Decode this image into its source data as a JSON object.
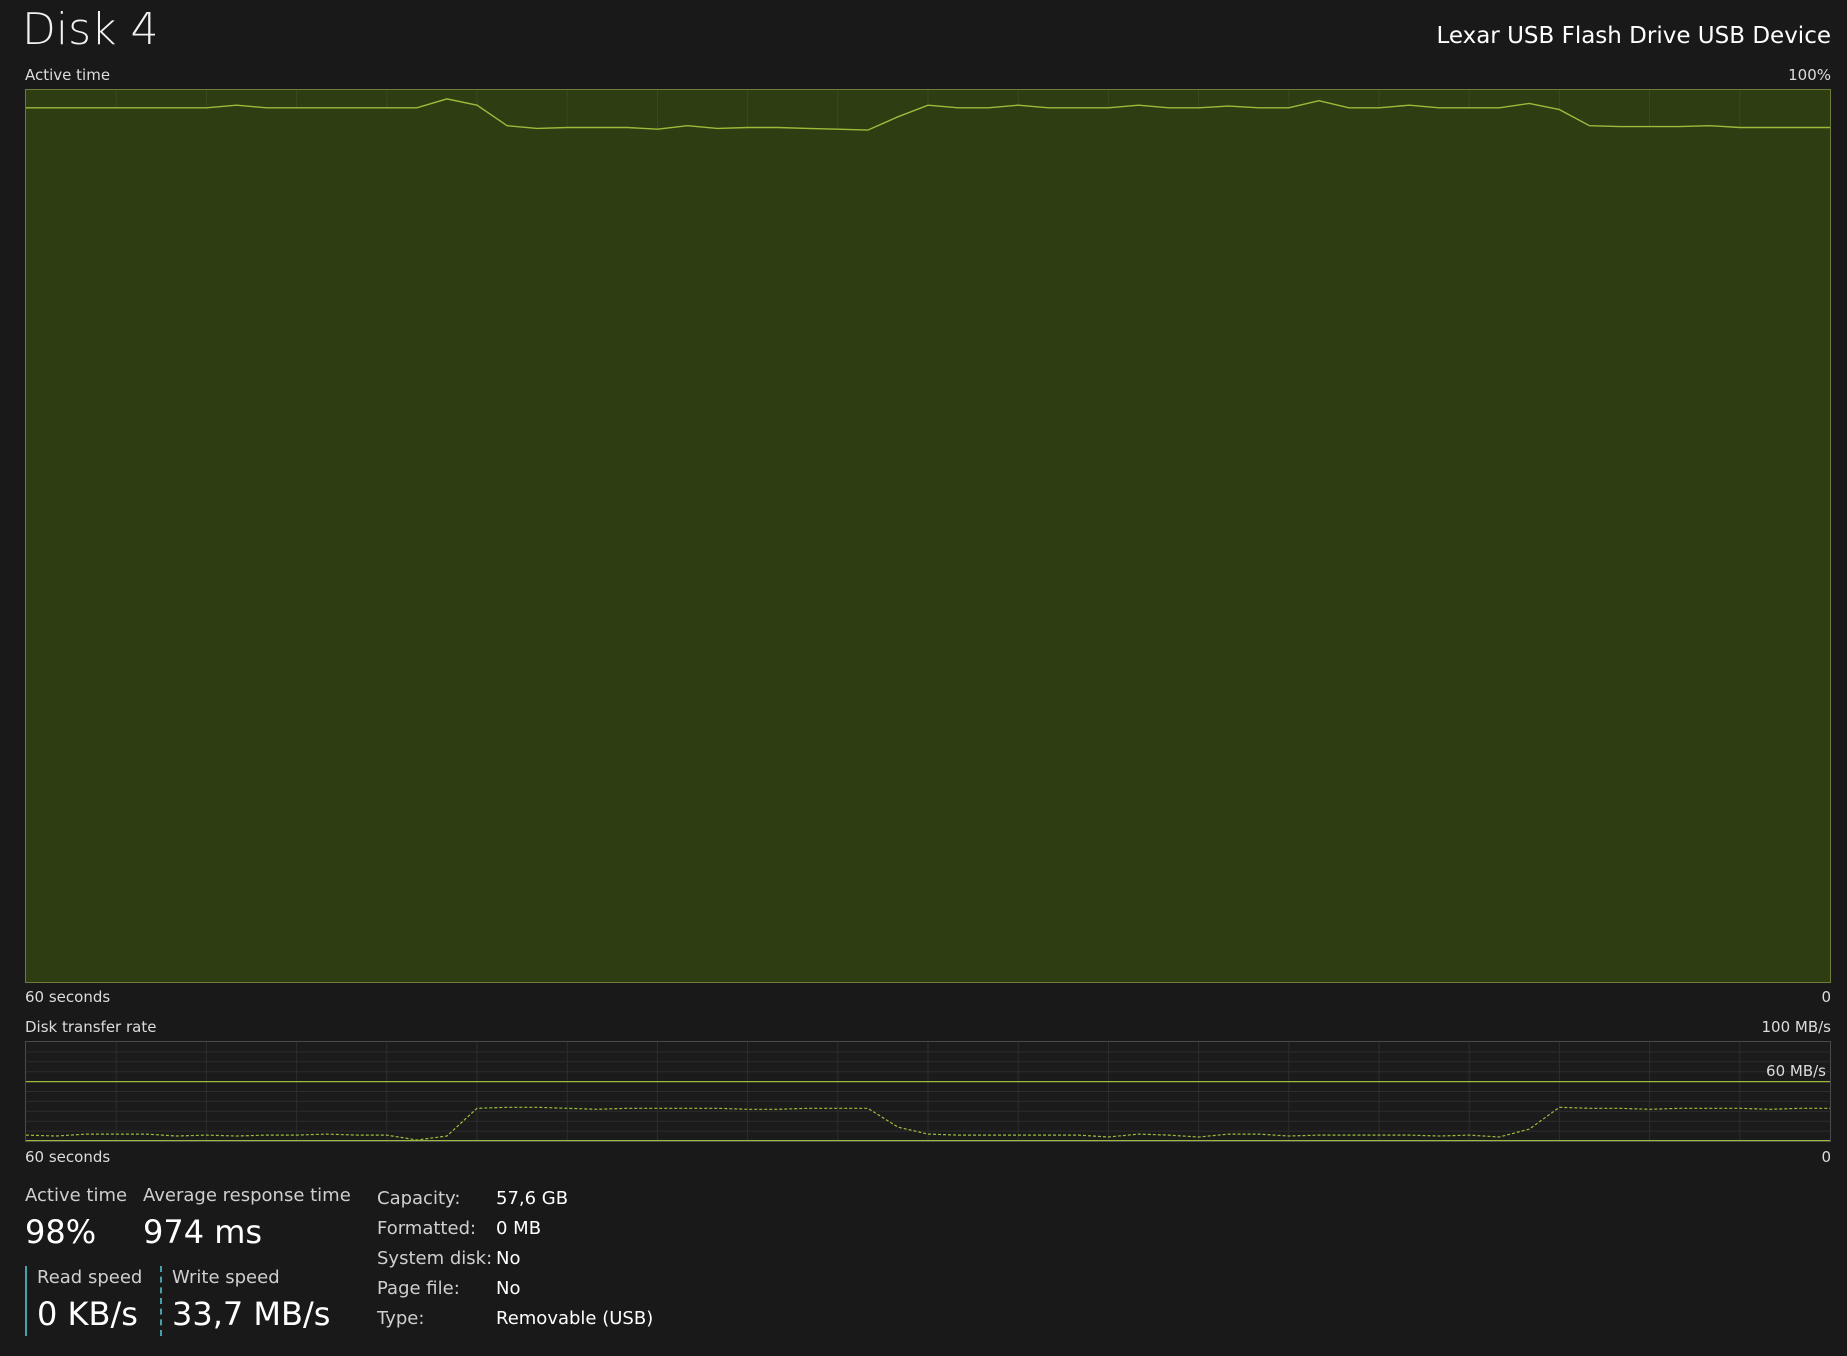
{
  "header": {
    "title": "Disk 4",
    "device": "Lexar USB Flash Drive USB Device"
  },
  "active_time_graph": {
    "label": "Active time",
    "max_label": "100%",
    "time_label": "60 seconds",
    "zero_label": "0",
    "values": [
      98,
      98,
      98,
      98,
      98,
      98,
      98,
      98.3,
      98,
      98,
      98,
      98,
      98,
      98,
      99,
      98.3,
      96,
      95.7,
      95.8,
      95.8,
      95.8,
      95.6,
      96,
      95.7,
      95.8,
      95.8,
      95.7,
      95.6,
      95.5,
      97,
      98.3,
      98,
      98,
      98.3,
      98,
      98,
      98,
      98.3,
      98,
      98,
      98.2,
      98,
      98,
      98.8,
      98,
      98,
      98.3,
      98,
      98,
      98,
      98.5,
      97.8,
      96,
      95.9,
      95.9,
      95.9,
      96,
      95.8,
      95.8,
      95.8,
      95.8
    ],
    "colors": {
      "fill": "#2e3d12",
      "line": "#9bbc3b",
      "grid": "#3a4a22"
    }
  },
  "transfer_graph": {
    "label": "Disk transfer rate",
    "max_label": "100 MB/s",
    "ref_label": "60 MB/s",
    "time_label": "60 seconds",
    "zero_label": "0",
    "ref_value": 60,
    "max_value": 100,
    "write_values": [
      6,
      5,
      7,
      7,
      7,
      5,
      6,
      5,
      6,
      6,
      7,
      6,
      6,
      1,
      5,
      33,
      34,
      34,
      33,
      32,
      33,
      33,
      33,
      33,
      32,
      32,
      33,
      33,
      33,
      14,
      7,
      6,
      6,
      6,
      6,
      6,
      4,
      7,
      6,
      4,
      7,
      7,
      5,
      6,
      6,
      6,
      6,
      5,
      6,
      4,
      12,
      34,
      33,
      33,
      32,
      33,
      33,
      33,
      32,
      33,
      33
    ],
    "read_values": [
      0,
      0,
      0,
      0,
      0,
      0,
      0,
      0,
      0,
      0,
      0,
      0,
      0,
      0,
      0,
      0,
      0,
      0,
      0,
      0,
      0,
      0,
      0,
      0,
      0,
      0,
      0,
      0,
      0,
      0,
      0,
      0,
      0,
      0,
      0,
      0,
      0,
      0,
      0,
      0,
      0,
      0,
      0,
      0,
      0,
      0,
      0,
      0,
      0,
      0,
      0,
      0,
      0,
      0,
      0,
      0,
      0,
      0,
      0,
      0,
      0
    ],
    "colors": {
      "line": "#9bbc3b",
      "grid": "#2d2d2d"
    }
  },
  "stats": {
    "active_time_label": "Active time",
    "active_time_value": "98%",
    "avg_response_label": "Average response time",
    "avg_response_value": "974 ms",
    "read_label": "Read speed",
    "read_value": "0 KB/s",
    "write_label": "Write speed",
    "write_value": "33,7 MB/s"
  },
  "properties": [
    {
      "key": "Capacity:",
      "value": "57,6 GB"
    },
    {
      "key": "Formatted:",
      "value": "0 MB"
    },
    {
      "key": "System disk:",
      "value": "No"
    },
    {
      "key": "Page file:",
      "value": "No"
    },
    {
      "key": "Type:",
      "value": "Removable (USB)"
    }
  ]
}
